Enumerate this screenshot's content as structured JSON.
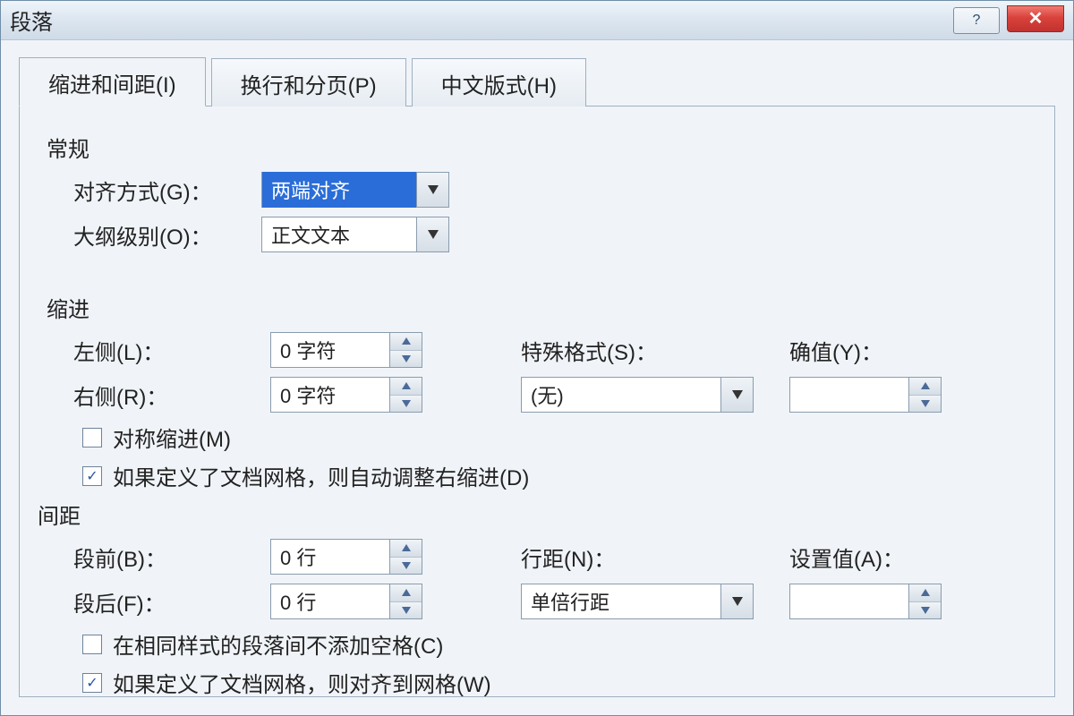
{
  "title": "段落",
  "tabs": {
    "indent": "缩进和间距(I)",
    "pagebreak": "换行和分页(P)",
    "chinese": "中文版式(H)"
  },
  "general": {
    "title": "常规",
    "alignment_label": "对齐方式(G)：",
    "alignment_value": "两端对齐",
    "outline_label": "大纲级别(O)：",
    "outline_value": "正文文本"
  },
  "indent": {
    "title": "缩进",
    "left_label": "左侧(L)：",
    "left_value": "0 字符",
    "right_label": "右侧(R)：",
    "right_value": "0 字符",
    "special_label": "特殊格式(S)：",
    "special_value": "(无)",
    "by_label": "确值(Y)：",
    "by_value": "",
    "mirror_label": "对称缩进(M)",
    "mirror_checked": false,
    "autogrid_label": "如果定义了文档网格，则自动调整右缩进(D)",
    "autogrid_checked": true
  },
  "spacing": {
    "title": "间距",
    "before_label": "段前(B)：",
    "before_value": "0 行",
    "after_label": "段后(F)：",
    "after_value": "0 行",
    "line_label": "行距(N)：",
    "line_value": "单倍行距",
    "at_label": "设置值(A)：",
    "at_value": "",
    "nospace_label": "在相同样式的段落间不添加空格(C)",
    "nospace_checked": false,
    "snapgrid_label": "如果定义了文档网格，则对齐到网格(W)",
    "snapgrid_checked": true
  }
}
